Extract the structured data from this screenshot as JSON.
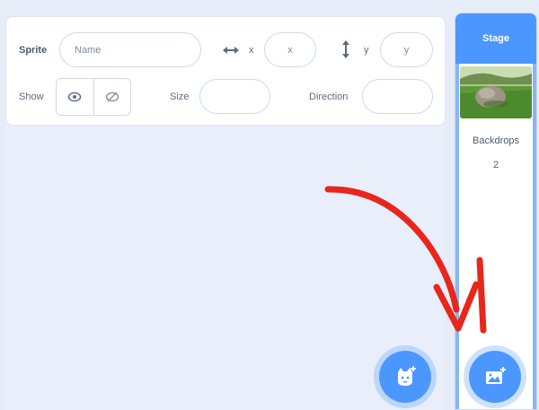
{
  "sprite_info": {
    "sprite_label": "Sprite",
    "name_placeholder": "Name",
    "x_label": "x",
    "x_placeholder": "x",
    "y_label": "y",
    "y_placeholder": "y",
    "show_label": "Show",
    "size_label": "Size",
    "direction_label": "Direction"
  },
  "stage": {
    "header": "Stage",
    "backdrops_label": "Backdrops",
    "backdrops_count": "2"
  },
  "icons": {
    "x_axis": "horizontal-arrows-icon",
    "y_axis": "vertical-arrows-icon",
    "show": "eye-icon",
    "hide": "eye-slash-icon",
    "choose_sprite": "cat-plus-icon",
    "choose_backdrop": "backdrop-plus-icon"
  },
  "colors": {
    "accent": "#4c97ff",
    "annotation_arrow": "#e8261b",
    "panel_bg": "#ffffff",
    "list_bg": "#e9effa"
  }
}
